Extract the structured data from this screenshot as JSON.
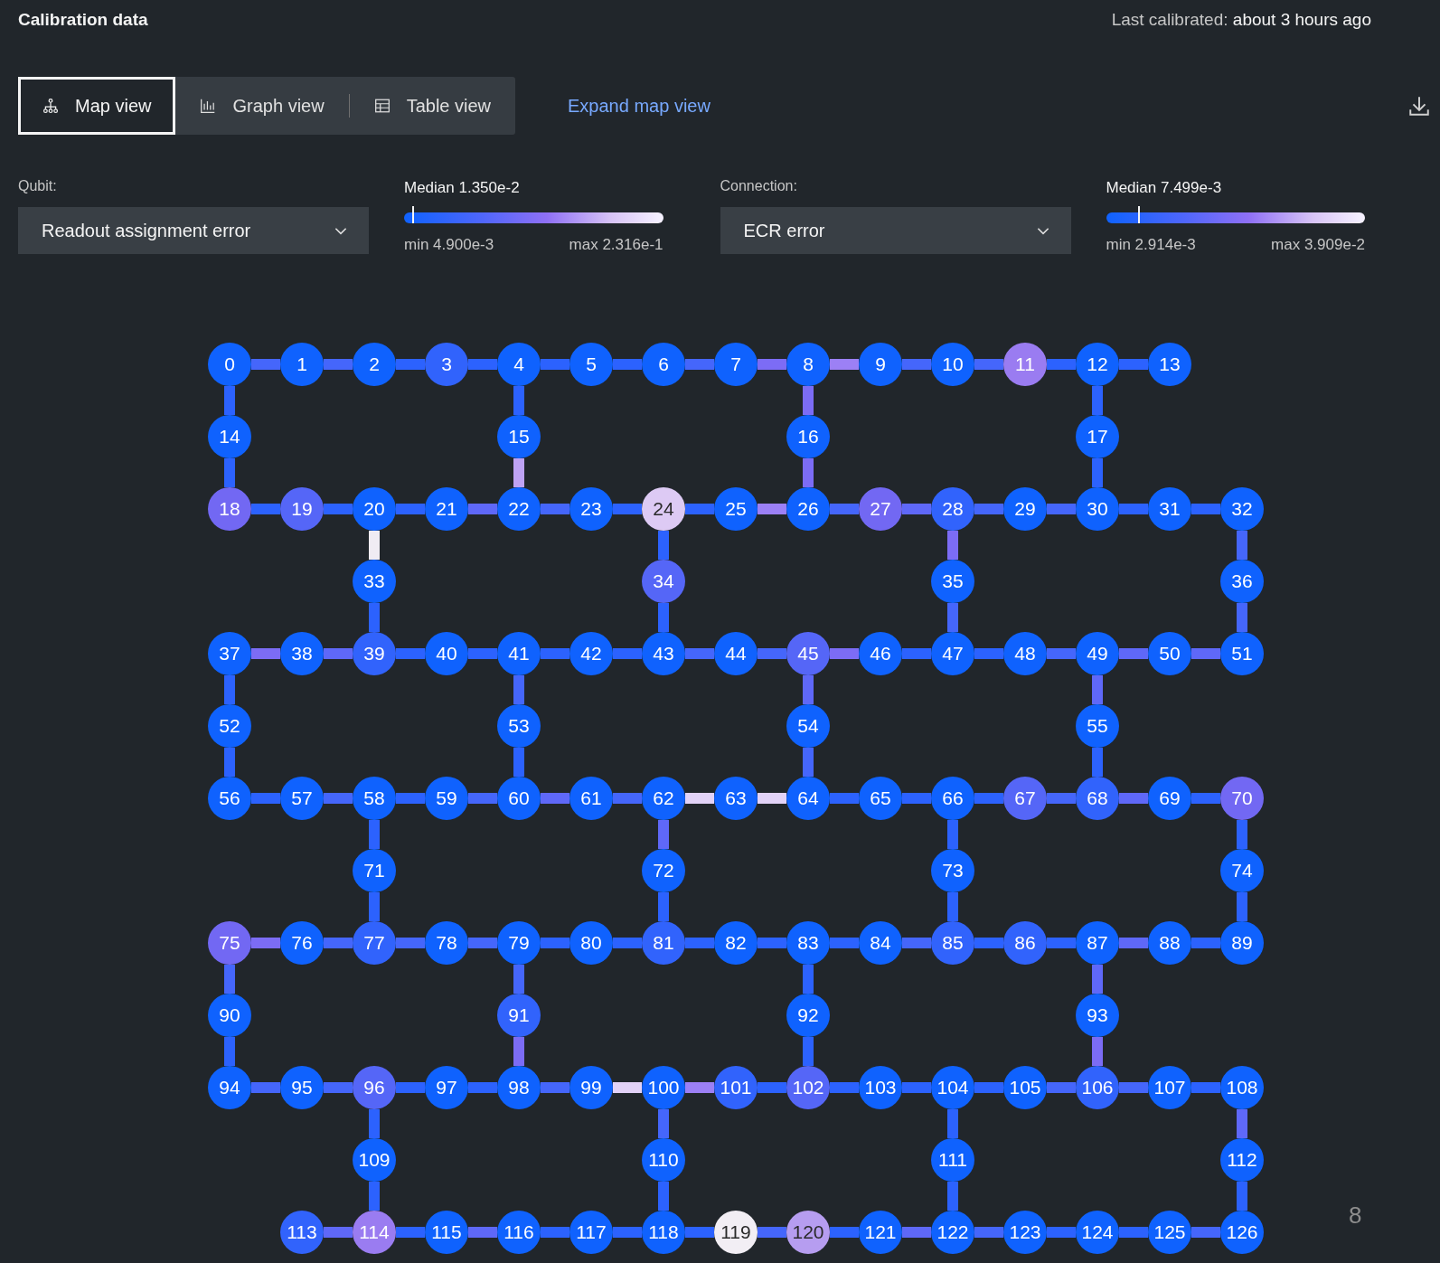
{
  "header": {
    "title": "Calibration data",
    "last_calibrated": "Last calibrated: **about 3 hours ago**"
  },
  "views": {
    "tabs": [
      {
        "label": "Map view",
        "kind": "map",
        "selected": true
      },
      {
        "label": "Graph view",
        "kind": "graph",
        "selected": false
      },
      {
        "label": "Table view",
        "kind": "table",
        "selected": false
      }
    ],
    "expand_link": "Expand map view"
  },
  "filters": [
    {
      "label": "Qubit:",
      "value": "Readout assignment error",
      "median": "Median 1.350e-2",
      "level": 0.035,
      "min": "min 4.900e-3",
      "max": "max 2.316e-1"
    },
    {
      "label": "Connection:",
      "value": "ECR error",
      "median": "Median 7.499e-3",
      "level": 0.127,
      "min": "min 2.914e-3",
      "max": "max 3.909e-2"
    }
  ],
  "map": {
    "rows": [
      {
        "kind": "main",
        "qubits": [
          {
            "label": "0",
            "color": "#0f62fe"
          },
          {
            "label": "1",
            "color": "#0f62fe"
          },
          {
            "label": "2",
            "color": "#0f62fe"
          },
          {
            "label": "3",
            "color": "#3163fc"
          },
          {
            "label": "4",
            "color": "#0f62fe"
          },
          {
            "label": "5",
            "color": "#0f62fe"
          },
          {
            "label": "6",
            "color": "#0f62fe"
          },
          {
            "label": "7",
            "color": "#0f62fe"
          },
          {
            "label": "8",
            "color": "#0f62fe"
          },
          {
            "label": "9",
            "color": "#0f62fe"
          },
          {
            "label": "10",
            "color": "#0f62fe"
          },
          {
            "label": "11",
            "color": "#9a7cf1"
          },
          {
            "label": "12",
            "color": "#0f62fe"
          },
          {
            "label": "13",
            "color": "#0f62fe"
          }
        ],
        "links": [
          {
            "color": "#4566fb"
          },
          {
            "color": "#4566fb"
          },
          {
            "color": "#2c62fe"
          },
          {
            "color": "#2c62fe"
          },
          {
            "color": "#2c62fe"
          },
          {
            "color": "#2c62fe"
          },
          {
            "color": "#4566fb"
          },
          {
            "color": "#7c6cf5"
          },
          {
            "color": "#9c80f5"
          },
          {
            "color": "#4566fb"
          },
          {
            "color": "#4566fb"
          },
          {
            "color": "#2c62fe"
          },
          {
            "color": "#2c62fe"
          }
        ]
      },
      {
        "kind": "bridge",
        "qubits": [
          {
            "label": "14",
            "color": "#0f62fe",
            "links": [
              {
                "color": "#2c62fe"
              },
              {
                "color": "#2c62fe"
              }
            ]
          },
          {
            "label": "15",
            "color": "#0f62fe",
            "links": [
              {
                "color": "#2c62fe"
              },
              {
                "color": "#bea2f4"
              }
            ]
          },
          {
            "label": "16",
            "color": "#0f62fe",
            "links": [
              {
                "color": "#7c6cf5"
              },
              {
                "color": "#7c6cf5"
              }
            ]
          },
          {
            "label": "17",
            "color": "#0f62fe",
            "links": [
              {
                "color": "#2c62fe"
              },
              {
                "color": "#2c62fe"
              }
            ]
          }
        ]
      },
      {
        "kind": "main",
        "qubits": [
          {
            "label": "18",
            "color": "#7268f3"
          },
          {
            "label": "19",
            "color": "#5566f7"
          },
          {
            "label": "20",
            "color": "#0f62fe"
          },
          {
            "label": "21",
            "color": "#0f62fe"
          },
          {
            "label": "22",
            "color": "#0f62fe"
          },
          {
            "label": "23",
            "color": "#0f62fe"
          },
          {
            "label": "24",
            "color": "#ddcaf4"
          },
          {
            "label": "25",
            "color": "#0f62fe"
          },
          {
            "label": "26",
            "color": "#0f62fe"
          },
          {
            "label": "27",
            "color": "#7268f3"
          },
          {
            "label": "28",
            "color": "#3163fc"
          },
          {
            "label": "29",
            "color": "#0f62fe"
          },
          {
            "label": "30",
            "color": "#0f62fe"
          },
          {
            "label": "31",
            "color": "#0f62fe"
          },
          {
            "label": "32",
            "color": "#0f62fe"
          }
        ],
        "links": [
          {
            "color": "#2c62fe"
          },
          {
            "color": "#2c62fe"
          },
          {
            "color": "#2c62fe"
          },
          {
            "color": "#5f68f8"
          },
          {
            "color": "#4566fb"
          },
          {
            "color": "#2c62fe"
          },
          {
            "color": "#2c62fe"
          },
          {
            "color": "#9c80f5"
          },
          {
            "color": "#4566fb"
          },
          {
            "color": "#5f68f8"
          },
          {
            "color": "#4566fb"
          },
          {
            "color": "#4566fb"
          },
          {
            "color": "#2c62fe"
          },
          {
            "color": "#2c62fe"
          }
        ]
      },
      {
        "kind": "bridge",
        "qubits": [
          {
            "label": "33",
            "color": "#0f62fe",
            "links": [
              {
                "color": "#f0ecf3"
              },
              {
                "color": "#2c62fe"
              }
            ]
          },
          {
            "label": "34",
            "color": "#5566f7",
            "links": [
              {
                "color": "#2c62fe"
              },
              {
                "color": "#2c62fe"
              }
            ]
          },
          {
            "label": "35",
            "color": "#0f62fe",
            "links": [
              {
                "color": "#7c6cf5"
              },
              {
                "color": "#4566fb"
              }
            ]
          },
          {
            "label": "36",
            "color": "#0f62fe",
            "links": [
              {
                "color": "#4566fb"
              },
              {
                "color": "#4566fb"
              }
            ]
          }
        ]
      },
      {
        "kind": "main",
        "qubits": [
          {
            "label": "37",
            "color": "#0f62fe"
          },
          {
            "label": "38",
            "color": "#0f62fe"
          },
          {
            "label": "39",
            "color": "#3163fc"
          },
          {
            "label": "40",
            "color": "#0f62fe"
          },
          {
            "label": "41",
            "color": "#0f62fe"
          },
          {
            "label": "42",
            "color": "#0f62fe"
          },
          {
            "label": "43",
            "color": "#0f62fe"
          },
          {
            "label": "44",
            "color": "#0f62fe"
          },
          {
            "label": "45",
            "color": "#5566f7"
          },
          {
            "label": "46",
            "color": "#0f62fe"
          },
          {
            "label": "47",
            "color": "#0f62fe"
          },
          {
            "label": "48",
            "color": "#0f62fe"
          },
          {
            "label": "49",
            "color": "#0f62fe"
          },
          {
            "label": "50",
            "color": "#0f62fe"
          },
          {
            "label": "51",
            "color": "#0f62fe"
          }
        ],
        "links": [
          {
            "color": "#7c6cf5"
          },
          {
            "color": "#5f68f8"
          },
          {
            "color": "#2c62fe"
          },
          {
            "color": "#2c62fe"
          },
          {
            "color": "#2c62fe"
          },
          {
            "color": "#2c62fe"
          },
          {
            "color": "#4566fb"
          },
          {
            "color": "#4566fb"
          },
          {
            "color": "#7c6cf5"
          },
          {
            "color": "#2c62fe"
          },
          {
            "color": "#2c62fe"
          },
          {
            "color": "#4566fb"
          },
          {
            "color": "#5f68f8"
          },
          {
            "color": "#5f68f8"
          }
        ]
      },
      {
        "kind": "bridge",
        "qubits": [
          {
            "label": "52",
            "color": "#0f62fe",
            "links": [
              {
                "color": "#2c62fe"
              },
              {
                "color": "#2c62fe"
              }
            ]
          },
          {
            "label": "53",
            "color": "#0f62fe",
            "links": [
              {
                "color": "#4566fb"
              },
              {
                "color": "#2c62fe"
              }
            ]
          },
          {
            "label": "54",
            "color": "#0f62fe",
            "links": [
              {
                "color": "#5f68f8"
              },
              {
                "color": "#4566fb"
              }
            ]
          },
          {
            "label": "55",
            "color": "#0f62fe",
            "links": [
              {
                "color": "#5f68f8"
              },
              {
                "color": "#2c62fe"
              }
            ]
          }
        ]
      },
      {
        "kind": "main",
        "qubits": [
          {
            "label": "56",
            "color": "#0f62fe"
          },
          {
            "label": "57",
            "color": "#0f62fe"
          },
          {
            "label": "58",
            "color": "#0f62fe"
          },
          {
            "label": "59",
            "color": "#0f62fe"
          },
          {
            "label": "60",
            "color": "#0f62fe"
          },
          {
            "label": "61",
            "color": "#0f62fe"
          },
          {
            "label": "62",
            "color": "#0f62fe"
          },
          {
            "label": "63",
            "color": "#0f62fe"
          },
          {
            "label": "64",
            "color": "#0f62fe"
          },
          {
            "label": "65",
            "color": "#0f62fe"
          },
          {
            "label": "66",
            "color": "#0f62fe"
          },
          {
            "label": "67",
            "color": "#5566f7"
          },
          {
            "label": "68",
            "color": "#3163fc"
          },
          {
            "label": "69",
            "color": "#0f62fe"
          },
          {
            "label": "70",
            "color": "#7268f3"
          }
        ],
        "links": [
          {
            "color": "#2c62fe"
          },
          {
            "color": "#4566fb"
          },
          {
            "color": "#2c62fe"
          },
          {
            "color": "#4566fb"
          },
          {
            "color": "#5f68f8"
          },
          {
            "color": "#4566fb"
          },
          {
            "color": "#e2d2f7"
          },
          {
            "color": "#e2d2f7"
          },
          {
            "color": "#2c62fe"
          },
          {
            "color": "#2c62fe"
          },
          {
            "color": "#2c62fe"
          },
          {
            "color": "#4566fb"
          },
          {
            "color": "#5f68f8"
          },
          {
            "color": "#2c62fe"
          }
        ]
      },
      {
        "kind": "bridge",
        "qubits": [
          {
            "label": "71",
            "color": "#0f62fe",
            "links": [
              {
                "color": "#2c62fe"
              },
              {
                "color": "#2c62fe"
              }
            ]
          },
          {
            "label": "72",
            "color": "#0f62fe",
            "links": [
              {
                "color": "#5f68f8"
              },
              {
                "color": "#2c62fe"
              }
            ]
          },
          {
            "label": "73",
            "color": "#0f62fe",
            "links": [
              {
                "color": "#2c62fe"
              },
              {
                "color": "#2c62fe"
              }
            ]
          },
          {
            "label": "74",
            "color": "#0f62fe",
            "links": [
              {
                "color": "#2c62fe"
              },
              {
                "color": "#2c62fe"
              }
            ]
          }
        ]
      },
      {
        "kind": "main",
        "qubits": [
          {
            "label": "75",
            "color": "#7268f3"
          },
          {
            "label": "76",
            "color": "#0f62fe"
          },
          {
            "label": "77",
            "color": "#3163fc"
          },
          {
            "label": "78",
            "color": "#0f62fe"
          },
          {
            "label": "79",
            "color": "#0f62fe"
          },
          {
            "label": "80",
            "color": "#0f62fe"
          },
          {
            "label": "81",
            "color": "#3163fc"
          },
          {
            "label": "82",
            "color": "#0f62fe"
          },
          {
            "label": "83",
            "color": "#0f62fe"
          },
          {
            "label": "84",
            "color": "#0f62fe"
          },
          {
            "label": "85",
            "color": "#3163fc"
          },
          {
            "label": "86",
            "color": "#3163fc"
          },
          {
            "label": "87",
            "color": "#0f62fe"
          },
          {
            "label": "88",
            "color": "#0f62fe"
          },
          {
            "label": "89",
            "color": "#0f62fe"
          }
        ],
        "links": [
          {
            "color": "#7c6cf5"
          },
          {
            "color": "#4566fb"
          },
          {
            "color": "#4566fb"
          },
          {
            "color": "#4566fb"
          },
          {
            "color": "#2c62fe"
          },
          {
            "color": "#2c62fe"
          },
          {
            "color": "#2c62fe"
          },
          {
            "color": "#2c62fe"
          },
          {
            "color": "#2c62fe"
          },
          {
            "color": "#4566fb"
          },
          {
            "color": "#2c62fe"
          },
          {
            "color": "#2c62fe"
          },
          {
            "color": "#5f68f8"
          },
          {
            "color": "#2c62fe"
          }
        ]
      },
      {
        "kind": "bridge",
        "qubits": [
          {
            "label": "90",
            "color": "#0f62fe",
            "links": [
              {
                "color": "#4566fb"
              },
              {
                "color": "#2c62fe"
              }
            ]
          },
          {
            "label": "91",
            "color": "#3163fc",
            "links": [
              {
                "color": "#4566fb"
              },
              {
                "color": "#7c6cf5"
              }
            ]
          },
          {
            "label": "92",
            "color": "#0f62fe",
            "links": [
              {
                "color": "#2c62fe"
              },
              {
                "color": "#2c62fe"
              }
            ]
          },
          {
            "label": "93",
            "color": "#0f62fe",
            "links": [
              {
                "color": "#5f68f8"
              },
              {
                "color": "#7c6cf5"
              }
            ]
          }
        ]
      },
      {
        "kind": "main",
        "qubits": [
          {
            "label": "94",
            "color": "#0f62fe"
          },
          {
            "label": "95",
            "color": "#0f62fe"
          },
          {
            "label": "96",
            "color": "#5566f7"
          },
          {
            "label": "97",
            "color": "#0f62fe"
          },
          {
            "label": "98",
            "color": "#0f62fe"
          },
          {
            "label": "99",
            "color": "#0f62fe"
          },
          {
            "label": "100",
            "color": "#0f62fe"
          },
          {
            "label": "101",
            "color": "#3163fc"
          },
          {
            "label": "102",
            "color": "#5566f7"
          },
          {
            "label": "103",
            "color": "#0f62fe"
          },
          {
            "label": "104",
            "color": "#0f62fe"
          },
          {
            "label": "105",
            "color": "#0f62fe"
          },
          {
            "label": "106",
            "color": "#3163fc"
          },
          {
            "label": "107",
            "color": "#0f62fe"
          },
          {
            "label": "108",
            "color": "#0f62fe"
          }
        ],
        "links": [
          {
            "color": "#4566fb"
          },
          {
            "color": "#4566fb"
          },
          {
            "color": "#2c62fe"
          },
          {
            "color": "#2c62fe"
          },
          {
            "color": "#4566fb"
          },
          {
            "color": "#e2d2f7"
          },
          {
            "color": "#9c80f5"
          },
          {
            "color": "#2c62fe"
          },
          {
            "color": "#2c62fe"
          },
          {
            "color": "#2c62fe"
          },
          {
            "color": "#2c62fe"
          },
          {
            "color": "#4566fb"
          },
          {
            "color": "#4566fb"
          },
          {
            "color": "#2c62fe"
          }
        ]
      },
      {
        "kind": "bridge",
        "qubits": [
          {
            "label": "109",
            "color": "#0f62fe",
            "links": [
              {
                "color": "#2c62fe"
              },
              {
                "color": "#2c62fe"
              }
            ]
          },
          {
            "label": "110",
            "color": "#0f62fe",
            "links": [
              {
                "color": "#4566fb"
              },
              {
                "color": "#2c62fe"
              }
            ]
          },
          {
            "label": "111",
            "color": "#0f62fe",
            "links": [
              {
                "color": "#2c62fe"
              },
              {
                "color": "#2c62fe"
              }
            ]
          },
          {
            "label": "112",
            "color": "#0f62fe",
            "links": [
              {
                "color": "#5f68f8"
              },
              {
                "color": "#2c62fe"
              }
            ]
          }
        ]
      },
      {
        "kind": "main",
        "qubits": [
          {
            "label": "113",
            "color": "#3163fc"
          },
          {
            "label": "114",
            "color": "#9a7cf1"
          },
          {
            "label": "115",
            "color": "#0f62fe"
          },
          {
            "label": "116",
            "color": "#0f62fe"
          },
          {
            "label": "117",
            "color": "#0f62fe"
          },
          {
            "label": "118",
            "color": "#0f62fe"
          },
          {
            "label": "119",
            "color": "#f2eef4"
          },
          {
            "label": "120",
            "color": "#b69df0"
          },
          {
            "label": "121",
            "color": "#0f62fe"
          },
          {
            "label": "122",
            "color": "#0f62fe"
          },
          {
            "label": "123",
            "color": "#0f62fe"
          },
          {
            "label": "124",
            "color": "#0f62fe"
          },
          {
            "label": "125",
            "color": "#0f62fe"
          },
          {
            "label": "126",
            "color": "#0f62fe"
          }
        ],
        "links": [
          {
            "color": "#5f68f8"
          },
          {
            "color": "#2c62fe"
          },
          {
            "color": "#5f68f8"
          },
          {
            "color": "#2c62fe"
          },
          {
            "color": "#2c62fe"
          },
          {
            "color": "#2c62fe"
          },
          {
            "color": "#4566fb"
          },
          {
            "color": "#2c62fe"
          },
          {
            "color": "#5f68f8"
          },
          {
            "color": "#4566fb"
          },
          {
            "color": "#2c62fe"
          },
          {
            "color": "#2c62fe"
          },
          {
            "color": "#4566fb"
          }
        ]
      }
    ],
    "corner_text": "8"
  }
}
